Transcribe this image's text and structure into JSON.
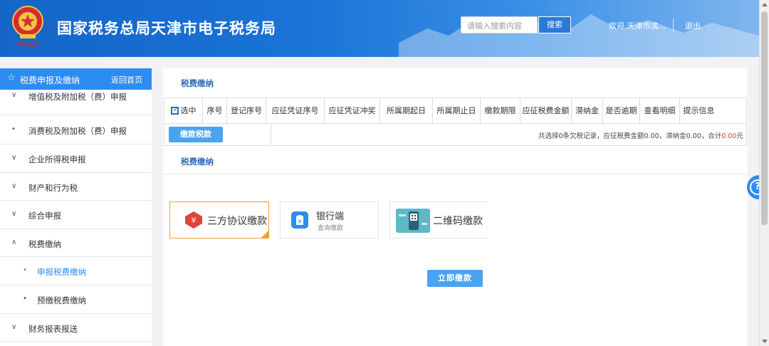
{
  "header": {
    "site_title": "国家税务总局天津市电子税务局",
    "search_placeholder": "请输入搜索内容",
    "search_button": "搜索",
    "welcome": "欢迎,天津市滨...",
    "logout": "退出",
    "brand_color": "#1a73d6"
  },
  "sidebar": {
    "header_title": "税费申报及缴纳",
    "home_link": "返回首页",
    "items": [
      {
        "icon": "chevron-down-icon",
        "glyph": "∨",
        "label": "增值税及附加税（费）申报"
      },
      {
        "icon": "bullet-icon",
        "glyph": "•",
        "label": "消费税及附加税（费）申报"
      },
      {
        "icon": "chevron-down-icon",
        "glyph": "∨",
        "label": "企业所得税申报"
      },
      {
        "icon": "chevron-down-icon",
        "glyph": "∨",
        "label": "财产和行为税"
      },
      {
        "icon": "chevron-down-icon",
        "glyph": "∨",
        "label": "综合申报"
      },
      {
        "icon": "chevron-up-icon",
        "glyph": "∧",
        "label": "税费缴纳"
      },
      {
        "icon": "bullet-icon",
        "glyph": "•",
        "label": "申报税费缴纳"
      },
      {
        "icon": "bullet-icon",
        "glyph": "•",
        "label": "预缴税费缴纳"
      },
      {
        "icon": "chevron-down-icon",
        "glyph": "∨",
        "label": "财务报表报送"
      }
    ],
    "active_color": "#2d8cf0"
  },
  "main": {
    "section1_title": "税费缴纳",
    "table_headers": [
      "选中",
      "序号",
      "登记序号",
      "应征凭证序号",
      "应征凭证冲奖",
      "所属期起日",
      "所属期止日",
      "缴款期限",
      "应征税费金额",
      "滞纳金",
      "是否逾期",
      "查看明细",
      "提示信息"
    ],
    "pay_button": "缴款税款",
    "summary_prefix": "共选择0条欠税记录，应征税费金额0.00，滞纳金0.00，合计",
    "summary_total": "0.00",
    "summary_suffix": "元",
    "section2_title": "税费缴纳",
    "methods": [
      {
        "label": "三方协议缴款",
        "icon": "tripartite-agreement-icon",
        "selected": true
      },
      {
        "label": "银行端",
        "sub": "查询缴款",
        "icon": "bank-icon",
        "selected": false
      },
      {
        "label": "二维码缴款",
        "icon": "qrcode-icon",
        "selected": false
      }
    ],
    "pay_now_button": "立即缴款",
    "total_color": "#e53935"
  },
  "help": {
    "icon": "help-icon",
    "glyph": "?"
  }
}
